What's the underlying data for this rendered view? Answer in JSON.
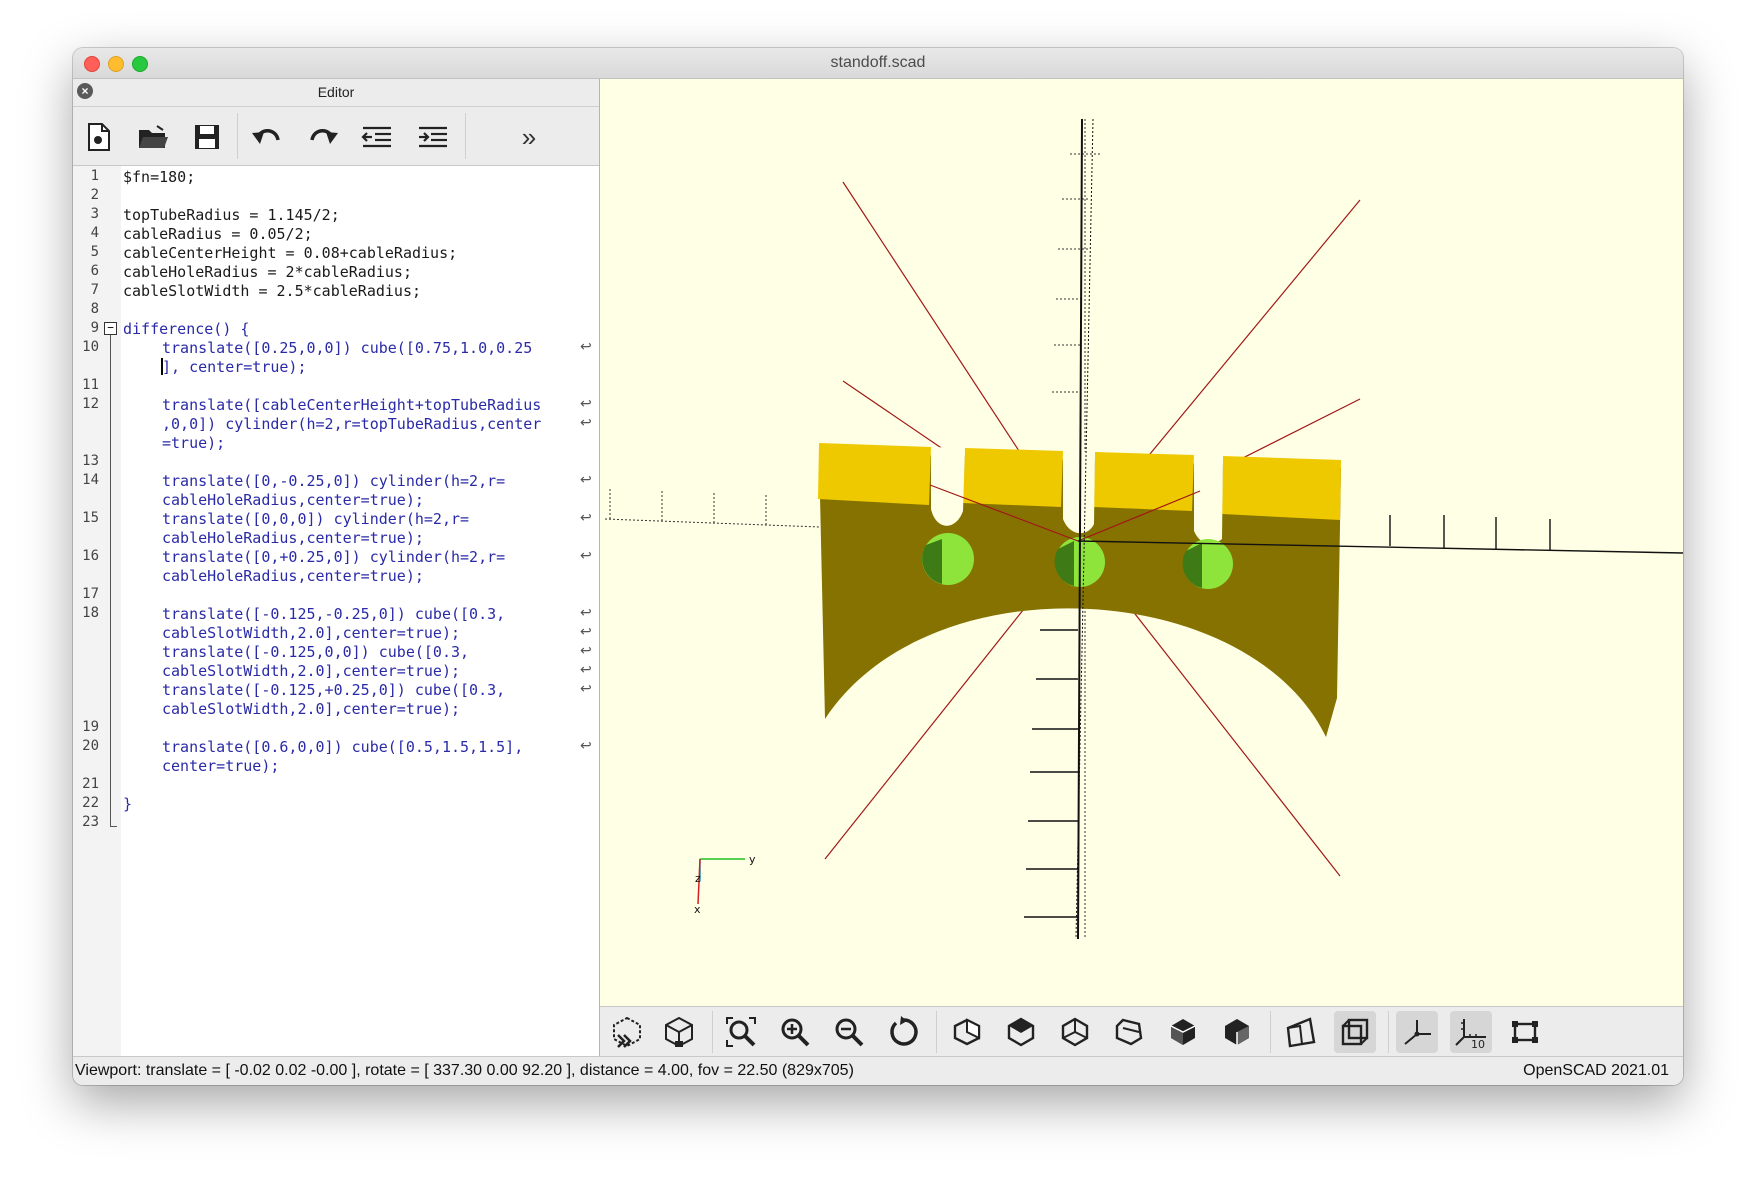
{
  "window": {
    "title": "standoff.scad"
  },
  "editor": {
    "title": "Editor",
    "toolbar": [
      {
        "name": "new-file",
        "icon": "new-file-icon"
      },
      {
        "name": "open-file",
        "icon": "folder-icon"
      },
      {
        "name": "save-file",
        "icon": "save-icon"
      },
      {
        "name": "undo",
        "icon": "undo-icon"
      },
      {
        "name": "redo",
        "icon": "redo-icon"
      },
      {
        "name": "unindent",
        "icon": "unindent-icon"
      },
      {
        "name": "indent",
        "icon": "indent-icon"
      },
      {
        "name": "more",
        "icon": "overflow-chevron-icon",
        "label": "»"
      }
    ],
    "line_numbers": [
      "1",
      "2",
      "3",
      "4",
      "5",
      "6",
      "7",
      "8",
      "9",
      "10",
      "11",
      "12",
      "13",
      "14",
      "15",
      "16",
      "17",
      "18",
      "19",
      "20",
      "21",
      "22",
      "23"
    ],
    "code": [
      "$fn=180;",
      "topTubeRadius = 1.145/2;",
      "cableRadius = 0.05/2;",
      "cableCenterHeight = 0.08+cableRadius;",
      "cableHoleRadius = 2*cableRadius;",
      "cableSlotWidth = 2.5*cableRadius;",
      "difference() {",
      "translate([0.25,0,0]) cube([0.75,1.0,0.25",
      "], center=true);",
      "translate([cableCenterHeight+topTubeRadius",
      ",0,0]) cylinder(h=2,r=topTubeRadius,center",
      "=true);",
      "translate([0,-0.25,0]) cylinder(h=2,r=",
      "cableHoleRadius,center=true);",
      "translate([0,0,0]) cylinder(h=2,r=",
      "cableHoleRadius,center=true);",
      "translate([0,+0.25,0]) cylinder(h=2,r=",
      "cableHoleRadius,center=true);",
      "translate([-0.125,-0.25,0]) cube([0.3,",
      "cableSlotWidth,2.0],center=true);",
      "translate([-0.125,0,0]) cube([0.3,",
      "cableSlotWidth,2.0],center=true);",
      "translate([-0.125,+0.25,0]) cube([0.3,",
      "cableSlotWidth,2.0],center=true);",
      "translate([0.6,0,0]) cube([0.5,1.5,1.5],",
      "center=true);",
      "}"
    ]
  },
  "viewport": {
    "axis_labels": {
      "y": "y",
      "z": "z",
      "x": "x"
    },
    "toolbar": [
      {
        "name": "preview",
        "icon": "preview-icon"
      },
      {
        "name": "render",
        "icon": "render-icon"
      },
      {
        "name": "view-all",
        "icon": "view-all-icon"
      },
      {
        "name": "zoom-in",
        "icon": "zoom-in-icon"
      },
      {
        "name": "zoom-out",
        "icon": "zoom-out-icon"
      },
      {
        "name": "reset-view",
        "icon": "reset-view-icon"
      },
      {
        "name": "view-right",
        "icon": "view-right-icon"
      },
      {
        "name": "view-top",
        "icon": "view-top-icon"
      },
      {
        "name": "view-bottom",
        "icon": "view-bottom-icon"
      },
      {
        "name": "view-left",
        "icon": "view-left-icon"
      },
      {
        "name": "view-front",
        "icon": "view-front-icon"
      },
      {
        "name": "view-back",
        "icon": "view-back-icon"
      },
      {
        "name": "perspective",
        "icon": "perspective-icon"
      },
      {
        "name": "orthogonal",
        "icon": "orthogonal-icon",
        "active": true
      },
      {
        "name": "show-axes",
        "icon": "axes-icon",
        "active": true
      },
      {
        "name": "show-scale-markers",
        "icon": "scale-markers-icon",
        "label": "10",
        "active": true
      },
      {
        "name": "show-edges",
        "icon": "edges-icon"
      }
    ],
    "colors": {
      "background": "#ffffe5",
      "top_face": "#eec900",
      "side_face": "#857200",
      "hole": "#8ee43a",
      "axis_line": "#a01818"
    }
  },
  "status": {
    "viewport_info": "Viewport: translate = [ -0.02 0.02 -0.00 ], rotate = [ 337.30 0.00 92.20 ], distance = 4.00, fov = 22.50 (829x705)",
    "version": "OpenSCAD 2021.01"
  }
}
